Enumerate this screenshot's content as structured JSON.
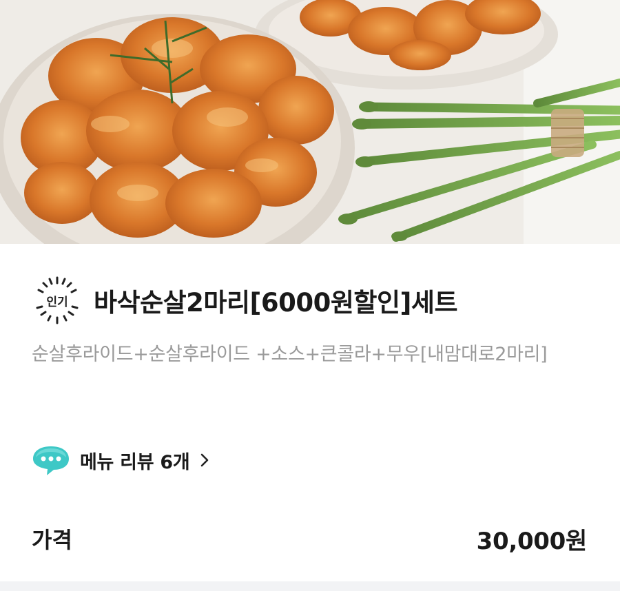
{
  "menu_item": {
    "badge_label": "인기",
    "title": "바삭순살2마리[6000원할인]세트",
    "description": "순살후라이드+순살후라이드 +소스+큰콜라+무우[내맘대로2마리]",
    "review_link_label": "메뉴 리뷰 6개",
    "price_label": "가격",
    "price_value": "30,000원"
  },
  "icons": {
    "badge": "popular-badge-icon",
    "review": "speech-bubble-icon",
    "chevron": "chevron-right-icon"
  },
  "colors": {
    "review_icon": "#3ec8c6",
    "description_text": "#9a9a9a"
  }
}
